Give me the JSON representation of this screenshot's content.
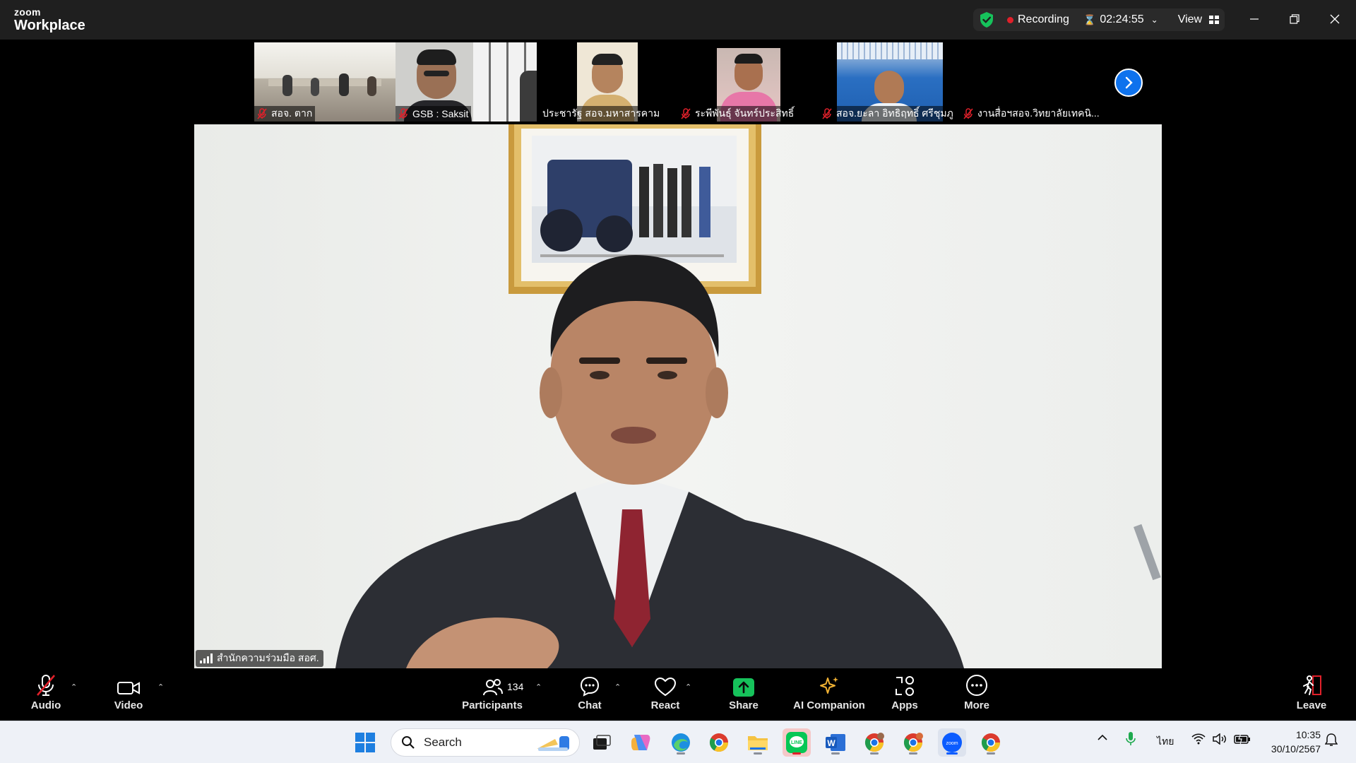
{
  "app": {
    "brand_small": "zoom",
    "brand_big": "Workplace"
  },
  "status": {
    "recording": "Recording",
    "elapsed": "02:24:55",
    "view": "View"
  },
  "participants_strip": [
    {
      "name": "สอจ. ตาก",
      "muted": true
    },
    {
      "name": "GSB : Saksit",
      "muted": true
    },
    {
      "name": "ประชารัฐ สอจ.มหาสารคาม",
      "muted": false
    },
    {
      "name": "ระพีพันธุ์ จันทร์ประสิทธิ์",
      "muted": true
    },
    {
      "name": "สอจ.ยะลา อิทธิฤทธิ์ ศรีชุมภู",
      "muted": true
    },
    {
      "name": "งานสื่อฯสอจ.วิทยาลัยเทคนิ...",
      "muted": true
    }
  ],
  "speaker": {
    "name": "สำนักความร่วมมือ สอศ."
  },
  "toolbar": {
    "audio": "Audio",
    "video": "Video",
    "participants": "Participants",
    "participants_count": "134",
    "chat": "Chat",
    "react": "React",
    "share": "Share",
    "ai_companion": "AI Companion",
    "apps": "Apps",
    "more": "More",
    "leave": "Leave"
  },
  "taskbar": {
    "search_placeholder": "Search",
    "language": "ไทย",
    "time": "10:35",
    "date": "30/10/2567"
  },
  "colors": {
    "accent": "#0e72ed",
    "share_green": "#16c25b",
    "record_red": "#e0202a",
    "leave_red": "#e0202a"
  }
}
